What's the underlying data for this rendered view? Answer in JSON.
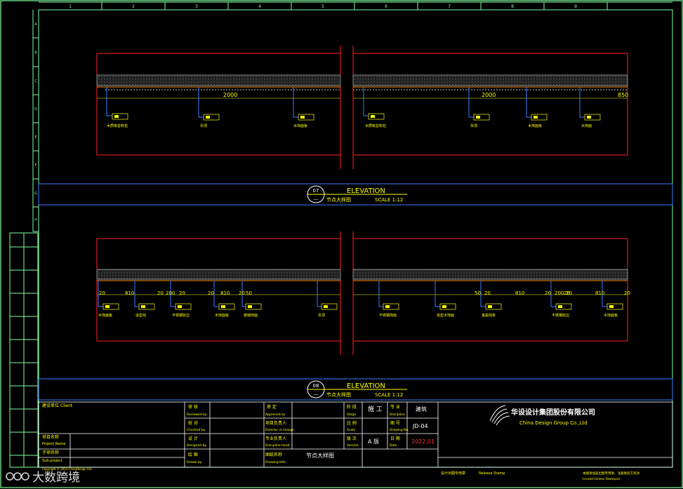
{
  "grid": {
    "columns": [
      "1",
      "2",
      "3",
      "4",
      "5",
      "6",
      "7",
      "8",
      "9"
    ],
    "rows": [
      "A",
      "B",
      "C",
      "D",
      "E",
      "F",
      "G",
      "H"
    ]
  },
  "drawing07": {
    "number": "07",
    "title": "ELEVATION",
    "subtitle": "节点大样图",
    "scale": "SCALE 1:12",
    "dims": [
      "2000",
      "2000",
      "850"
    ],
    "labels": [
      "木质吸音软包",
      "吊顶",
      "木饰面板",
      "木质吸音软包",
      "吊顶",
      "木饰面板",
      "木饰面"
    ]
  },
  "drawing08": {
    "number": "08",
    "title": "ELEVATION",
    "subtitle": "节点大样图",
    "scale": "SCALE 1:12",
    "dims": [
      "20",
      "810",
      "20",
      "200",
      "20",
      "20",
      "810",
      "20",
      "50",
      "50",
      "20",
      "810",
      "20",
      "200",
      "20",
      "20",
      "810",
      "20"
    ],
    "labels": [
      "木饰面板",
      "造型线",
      "不锈钢收边",
      "木饰面板",
      "玻璃饰面",
      "吊顶",
      "不锈钢饰面",
      "造型木饰面",
      "金属线条",
      "不锈钢收边",
      "木饰面板"
    ]
  },
  "titleblock": {
    "client_label": "建设单位 Client",
    "project_label": "项目名称",
    "project_label_en": "Project Name",
    "subproject_label": "子项名称",
    "subproject_label_en": "Sub-project",
    "copyright": "Copyright © 2023 ChinaDesign Ltd.",
    "reviewed": "审 核",
    "reviewed_en": "Reviewed by",
    "checked": "校 对",
    "checked_en": "Checked by",
    "designed": "设 计",
    "designed_en": "Designed by",
    "drawn": "绘 图",
    "drawn_en": "Drawn by",
    "approved": "审 定",
    "approved_en": "Approved by",
    "director": "项目负责人",
    "director_en": "Director in charge",
    "discipline_head": "专业负责人",
    "discipline_head_en": "Discipline head",
    "drawing_name_label": "图纸名称",
    "drawing_name_label_en": "Drawing title",
    "drawing_name": "节点大样图",
    "stage_label": "阶 段",
    "stage_label_en": "Stage",
    "stage": "施 工",
    "discipline_label": "专 业",
    "discipline_label_en": "Discipline",
    "discipline": "建筑",
    "scale_label": "比 例",
    "scale_label_en": "Scale",
    "dwg_no_label": "图 号",
    "dwg_no_label_en": "Drawing No.",
    "dwg_no": "JD-04",
    "version_label": "版 次",
    "version_label_en": "Version",
    "version": "A 版",
    "date_label": "日 期",
    "date_label_en": "Date",
    "date": "2022.01",
    "stamp_label": "设计出图专用章",
    "stamp_label_en": "Release Stamp",
    "company_cn": "华设设计集团股份有限公司",
    "company_en": "China Design Group Co.,Ltd",
    "note_cn": "本图须加盖出图专用章、注册章后方有效",
    "note_en": "Invalid Unless Stamped"
  },
  "watermark": "大数跨境",
  "colors": {
    "frame": "#7fff9f",
    "red": "#ff2020",
    "blue": "#3a7bff",
    "yellow": "#ffff00"
  }
}
